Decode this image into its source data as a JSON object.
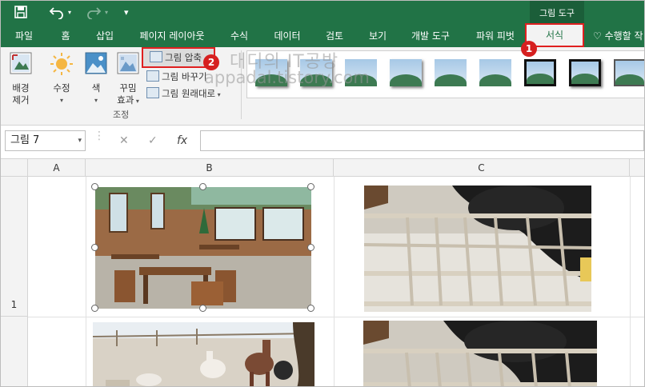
{
  "titlebar": {
    "context_group": "그림 도구",
    "icons": [
      "save-icon",
      "undo-icon",
      "redo-icon",
      "customize-icon"
    ],
    "brand_color": "#217346"
  },
  "tabs": [
    {
      "label": "파일"
    },
    {
      "label": "홈"
    },
    {
      "label": "삽입"
    },
    {
      "label": "페이지 레이아웃"
    },
    {
      "label": "수식"
    },
    {
      "label": "데이터"
    },
    {
      "label": "검토"
    },
    {
      "label": "보기"
    },
    {
      "label": "개발 도구"
    },
    {
      "label": "파워 피벗"
    },
    {
      "label": "서식"
    }
  ],
  "tell_me": "수행할 작",
  "ribbon": {
    "remove_background": [
      "배경",
      "제거"
    ],
    "corrections": "수정",
    "color": "색",
    "artistic_effects": [
      "꾸밈",
      "효과"
    ],
    "compress": "그림 압축",
    "change_picture": "그림 바꾸기",
    "reset_picture": "그림 원래대로",
    "group_label": "조정"
  },
  "watermark": {
    "line1": "대디의 IT공방",
    "line2": "appadal.tistory.com"
  },
  "badges": {
    "first": "1",
    "second": "2"
  },
  "formula_bar": {
    "name_box": "그림 7",
    "fx": "fx",
    "value": ""
  },
  "columns": [
    "A",
    "B",
    "C"
  ],
  "rows": [
    "1"
  ],
  "highlight_color": "#e02020"
}
